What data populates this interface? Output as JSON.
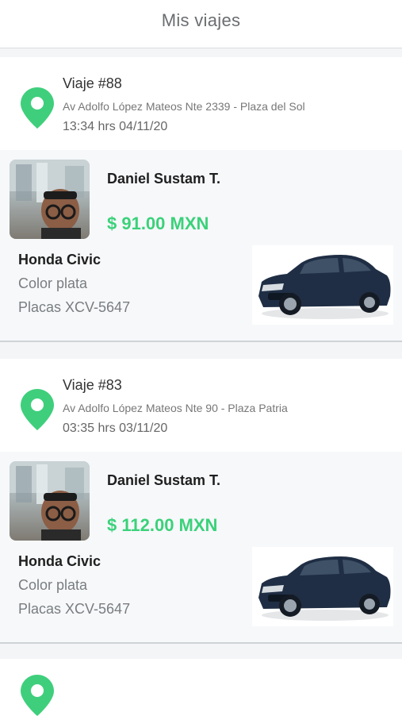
{
  "header": {
    "title": "Mis viajes"
  },
  "trips": [
    {
      "title": "Viaje #88",
      "address": "Av Adolfo López Mateos Nte 2339 - Plaza del Sol",
      "time": "13:34 hrs 04/11/20",
      "driver_name": "Daniel Sustam T.",
      "price": "$ 91.00 MXN",
      "car_model": "Honda Civic",
      "car_color": "Color plata",
      "car_plates": "Placas XCV-5647"
    },
    {
      "title": "Viaje #83",
      "address": "Av Adolfo López Mateos Nte 90 - Plaza Patria",
      "time": "03:35 hrs 03/11/20",
      "driver_name": "Daniel Sustam T.",
      "price": "$ 112.00 MXN",
      "car_model": "Honda Civic",
      "car_color": "Color plata",
      "car_plates": "Placas XCV-5647"
    }
  ],
  "colors": {
    "accent_green": "#3bd17a",
    "pin_green": "#3fcf7c",
    "divider": "#cfd3d6"
  },
  "icons": {
    "location": "location-pin-icon"
  }
}
